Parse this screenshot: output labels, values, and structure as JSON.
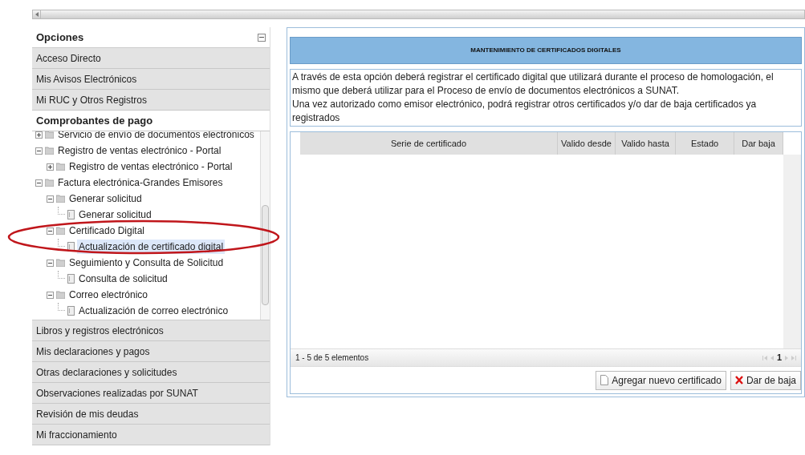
{
  "sidebar": {
    "title": "Opciones",
    "sections": [
      {
        "label": "Acceso Directo",
        "expanded": false
      },
      {
        "label": "Mis Avisos Electrónicos",
        "expanded": false
      },
      {
        "label": "Mi RUC y Otros Registros",
        "expanded": false
      },
      {
        "label": "Comprobantes de pago",
        "expanded": true,
        "tree": [
          {
            "label": "Servicio de envío de documentos electrónicos",
            "kind": "folder",
            "expanded": false,
            "selected": false
          },
          {
            "label": "Registro de ventas electrónico - Portal",
            "kind": "folder",
            "expanded": true,
            "selected": false,
            "children": [
              {
                "label": "Registro de ventas electrónico - Portal",
                "kind": "folder",
                "expanded": false,
                "selected": false
              }
            ]
          },
          {
            "label": "Factura electrónica-Grandes Emisores",
            "kind": "folder",
            "expanded": true,
            "selected": false,
            "children": [
              {
                "label": "Generar solicitud",
                "kind": "folder",
                "expanded": true,
                "selected": false,
                "children": [
                  {
                    "label": "Generar solicitud",
                    "kind": "leaf",
                    "selected": false
                  }
                ]
              },
              {
                "label": "Certificado Digital",
                "kind": "folder",
                "expanded": true,
                "selected": false,
                "children": [
                  {
                    "label": "Actualización de certificado digital",
                    "kind": "leaf",
                    "selected": true
                  }
                ]
              },
              {
                "label": "Seguimiento y Consulta de Solicitud",
                "kind": "folder",
                "expanded": true,
                "selected": false,
                "children": [
                  {
                    "label": "Consulta de solicitud",
                    "kind": "leaf",
                    "selected": false
                  }
                ]
              },
              {
                "label": "Correo electrónico",
                "kind": "folder",
                "expanded": true,
                "selected": false,
                "children": [
                  {
                    "label": "Actualización de correo electrónico",
                    "kind": "leaf",
                    "selected": false
                  }
                ]
              }
            ]
          }
        ]
      },
      {
        "label": "Libros y registros electrónicos",
        "expanded": false
      },
      {
        "label": "Mis declaraciones y pagos",
        "expanded": false
      },
      {
        "label": "Otras declaraciones y solicitudes",
        "expanded": false
      },
      {
        "label": "Observaciones realizadas por SUNAT",
        "expanded": false
      },
      {
        "label": "Revisión de mis deudas",
        "expanded": false
      },
      {
        "label": "Mi fraccionamiento",
        "expanded": false
      }
    ]
  },
  "main": {
    "title": "MANTENIMIENTO DE CERTIFICADOS DIGITALES",
    "description": [
      "A través de esta opción deberá registrar el certificado digital que utilizará durante el proceso de homologación, el mismo que deberá utilizar para el Proceso de envío de documentos electrónicos a SUNAT.",
      "Una vez autorizado como emisor electrónico, podrá registrar otros certificados y/o dar de baja certificados ya registrados"
    ],
    "grid": {
      "columns": [
        "Serie de certificado",
        "Valido desde",
        "Valido hasta",
        "Estado",
        "Dar baja"
      ],
      "pager_summary": "1 - 5 de 5 elementos",
      "current_page": "1"
    },
    "buttons": [
      {
        "label": "Agregar nuevo certificado",
        "kind": "add"
      },
      {
        "label": "Dar de baja",
        "kind": "remove"
      }
    ]
  }
}
